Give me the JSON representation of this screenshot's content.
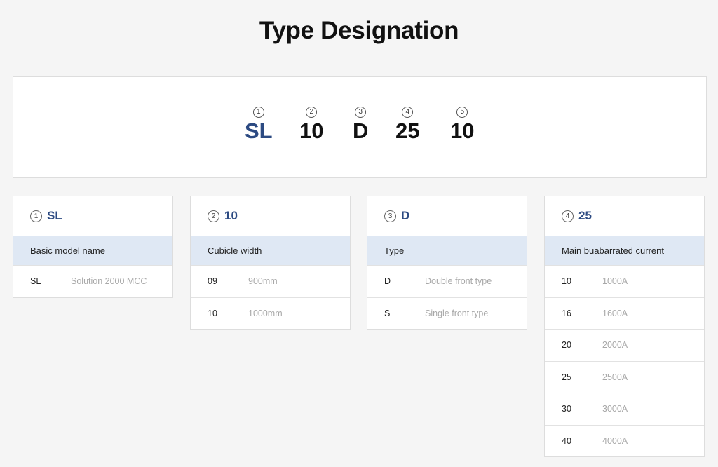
{
  "page": {
    "title": "Type Designation"
  },
  "code_panel": {
    "segments": [
      {
        "num": "1",
        "value": "SL",
        "accent": true
      },
      {
        "num": "2",
        "value": "10",
        "accent": false
      },
      {
        "num": "3",
        "value": "D",
        "accent": false
      },
      {
        "num": "4",
        "value": "25",
        "accent": false
      },
      {
        "num": "5",
        "value": "10",
        "accent": false
      }
    ]
  },
  "cards": [
    {
      "num": "1",
      "code": "SL",
      "heading": "Basic model name",
      "rows": [
        {
          "k": "SL",
          "v": "Solution 2000 MCC"
        }
      ]
    },
    {
      "num": "2",
      "code": "10",
      "heading": "Cubicle width",
      "rows": [
        {
          "k": "09",
          "v": "900mm"
        },
        {
          "k": "10",
          "v": "1000mm"
        }
      ]
    },
    {
      "num": "3",
      "code": "D",
      "heading": "Type",
      "rows": [
        {
          "k": "D",
          "v": "Double front type"
        },
        {
          "k": "S",
          "v": "Single front type"
        }
      ]
    },
    {
      "num": "4",
      "code": "25",
      "heading": "Main buabarrated current",
      "rows": [
        {
          "k": "10",
          "v": "1000A"
        },
        {
          "k": "16",
          "v": "1600A"
        },
        {
          "k": "20",
          "v": "2000A"
        },
        {
          "k": "25",
          "v": "2500A"
        },
        {
          "k": "30",
          "v": "3000A"
        },
        {
          "k": "40",
          "v": "4000A"
        }
      ]
    }
  ],
  "colors": {
    "accent": "#2c4a82",
    "subheader_bg": "#dfe8f4",
    "page_bg": "#f5f5f5"
  }
}
